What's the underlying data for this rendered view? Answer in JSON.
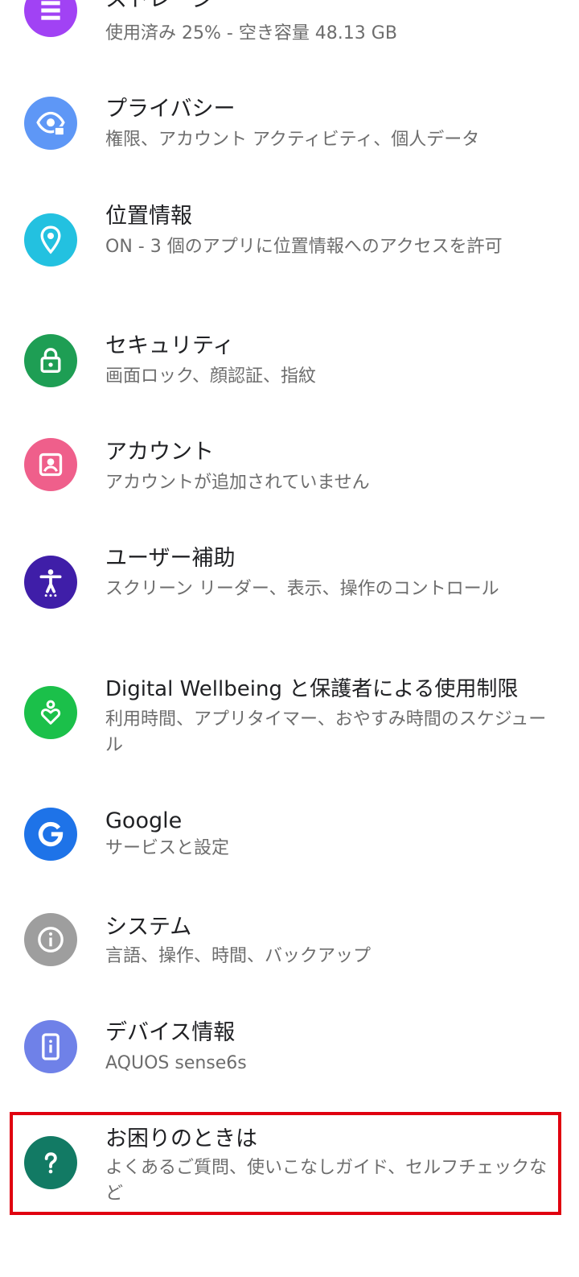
{
  "items": [
    {
      "title": "ストレージ",
      "subtitle": "使用済み 25% - 空き容量 48.13 GB",
      "icon": "storage-icon",
      "color": "#a142f4"
    },
    {
      "title": "プライバシー",
      "subtitle": "権限、アカウント アクティビティ、個人データ",
      "icon": "privacy-icon",
      "color": "#5e97f6"
    },
    {
      "title": "位置情報",
      "subtitle": "ON - 3 個のアプリに位置情報へのアクセスを許可",
      "icon": "location-icon",
      "color": "#23c1e0"
    },
    {
      "title": "セキュリティ",
      "subtitle": "画面ロック、顔認証、指紋",
      "icon": "lock-icon",
      "color": "#1e9e54"
    },
    {
      "title": "アカウント",
      "subtitle": "アカウントが追加されていません",
      "icon": "account-icon",
      "color": "#ef5f8b"
    },
    {
      "title": "ユーザー補助",
      "subtitle": "スクリーン リーダー、表示、操作のコントロール",
      "icon": "accessibility-icon",
      "color": "#3f1ea8"
    },
    {
      "title": "Digital Wellbeing と保護者による使用制限",
      "subtitle": "利用時間、アプリタイマー、おやすみ時間のスケジュール",
      "icon": "wellbeing-icon",
      "color": "#1bc04a"
    },
    {
      "title": "Google",
      "subtitle": "サービスと設定",
      "icon": "google-icon",
      "color": "#1e73e8"
    },
    {
      "title": "システム",
      "subtitle": "言語、操作、時間、バックアップ",
      "icon": "info-icon",
      "color": "#9e9e9e"
    },
    {
      "title": "デバイス情報",
      "subtitle": "AQUOS sense6s",
      "icon": "device-info-icon",
      "color": "#6f81e8"
    },
    {
      "title": "お困りのときは",
      "subtitle": "よくあるご質問、使いこなしガイド、セルフチェックなど",
      "icon": "help-icon",
      "color": "#127a64"
    }
  ],
  "highlight_color": "#e0000f"
}
